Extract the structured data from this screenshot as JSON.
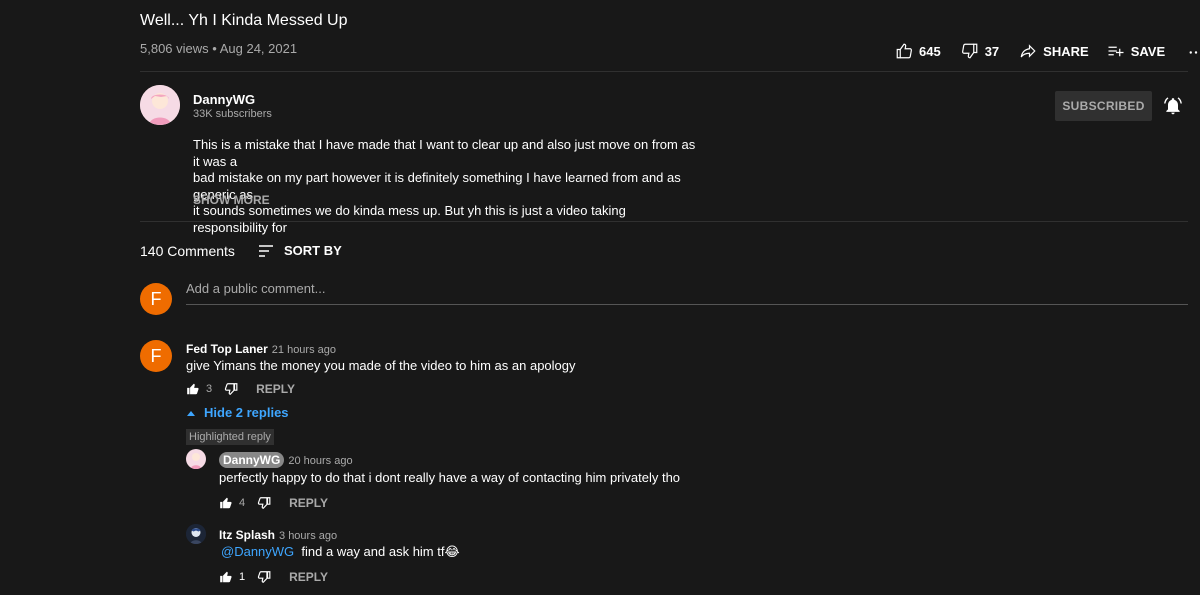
{
  "video": {
    "title": "Well... Yh I Kinda Messed Up",
    "views": "5,806 views",
    "date": "Aug 24, 2021",
    "likes": "645",
    "dislikes": "37",
    "share_label": "SHARE",
    "save_label": "SAVE"
  },
  "channel": {
    "name": "DannyWG",
    "subscribers": "33K subscribers",
    "subscribed_label": "SUBSCRIBED"
  },
  "description": {
    "line1": "This is a mistake that I have made that I want to clear up and also just move on from as it was a",
    "line2": "bad mistake on my part however it is definitely something I have learned from and as generic as",
    "line3": "it sounds sometimes we do kinda mess up. But yh this is just a video taking responsibility for",
    "show_more": "SHOW MORE"
  },
  "comments_header": {
    "count": "140 Comments",
    "sort_label": "SORT BY"
  },
  "add_comment": {
    "avatar_letter": "F",
    "placeholder": "Add a public comment..."
  },
  "comment": {
    "avatar_letter": "F",
    "author": "Fed Top Laner",
    "time": "21 hours ago",
    "text": "give Yimans the money you made of the video to him as an apology",
    "likes": "3",
    "reply_label": "REPLY",
    "hide_replies": "Hide 2 replies",
    "highlighted_label": "Highlighted reply"
  },
  "replies": [
    {
      "author": "DannyWG",
      "time": "20 hours ago",
      "text": "perfectly happy to do that i dont really have a way of contacting him privately tho",
      "likes": "4",
      "reply_label": "REPLY"
    },
    {
      "author": "Itz Splash",
      "time": "3 hours ago",
      "mention": "@DannyWG",
      "text": "find a way and ask him tf😂",
      "likes": "1",
      "reply_label": "REPLY"
    }
  ],
  "icons": {
    "like": "thumb-up-icon",
    "dislike": "thumb-down-icon",
    "share": "share-arrow-icon",
    "save": "playlist-add-icon",
    "more": "more-horizontal-icon",
    "bell": "bell-ringing-icon",
    "sort": "sort-lines-icon",
    "chevron": "chevron-up-icon"
  },
  "colors": {
    "background": "#181818",
    "accent_link": "#3ea6ff",
    "avatar_orange": "#ef6c00",
    "muted_text": "#aaaaaa"
  }
}
